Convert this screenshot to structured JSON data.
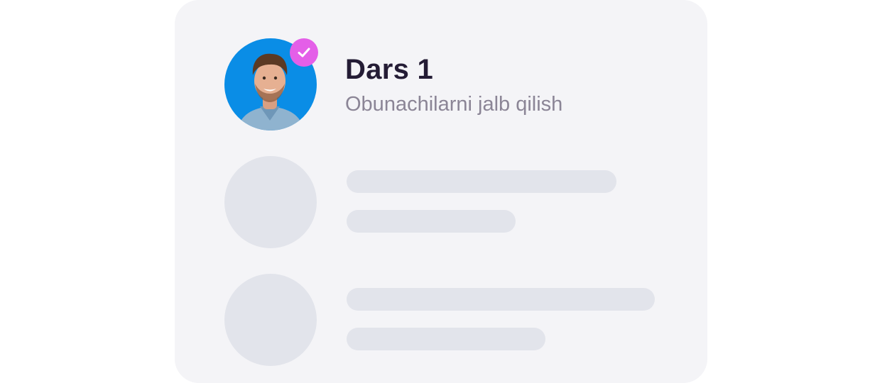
{
  "lesson": {
    "title": "Dars 1",
    "subtitle": "Obunachilarni jalb qilish",
    "avatar_icon": "person-photo",
    "badge_icon": "check-icon",
    "badge_color": "#e45fe8",
    "avatar_bg_color": "#0a8de6"
  },
  "placeholders": [
    {
      "icon": "placeholder-avatar"
    },
    {
      "icon": "placeholder-avatar"
    }
  ],
  "colors": {
    "card_bg": "#f4f4f7",
    "placeholder": "#e2e4eb",
    "title": "#241c35",
    "subtitle": "#8b8596"
  }
}
